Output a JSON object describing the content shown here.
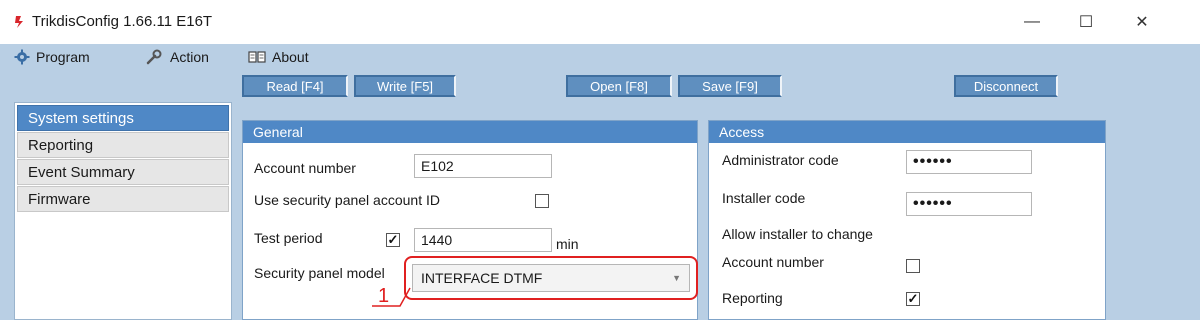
{
  "window": {
    "title": "TrikdisConfig 1.66.11   E16T",
    "minimize_glyph": "—",
    "maximize_glyph": "☐",
    "close_glyph": "✕"
  },
  "menu": {
    "program": "Program",
    "action": "Action",
    "about": "About"
  },
  "toolbar": {
    "read": "Read [F4]",
    "write": "Write [F5]",
    "open": "Open [F8]",
    "save": "Save [F9]",
    "disconnect": "Disconnect"
  },
  "sidebar": {
    "items": [
      {
        "label": "System settings",
        "active": true
      },
      {
        "label": "Reporting",
        "active": false
      },
      {
        "label": "Event Summary",
        "active": false
      },
      {
        "label": "Firmware",
        "active": false
      }
    ]
  },
  "general": {
    "title": "General",
    "account_number_label": "Account number",
    "account_number_value": "E102",
    "use_panel_id_label": "Use security panel account ID",
    "use_panel_id_checked": false,
    "test_period_label": "Test period",
    "test_period_checked": true,
    "test_period_value": "1440",
    "test_period_unit": "min",
    "panel_model_label": "Security panel model",
    "panel_model_value": "INTERFACE DTMF"
  },
  "access": {
    "title": "Access",
    "admin_code_label": "Administrator code",
    "admin_code_value": "••••••",
    "installer_code_label": "Installer code",
    "installer_code_value": "••••••",
    "allow_change_label": "Allow installer to change",
    "account_number_label": "Account number",
    "account_number_checked": false,
    "reporting_label": "Reporting",
    "reporting_checked": true
  },
  "callout": {
    "number": "1",
    "color": "#e02020"
  },
  "colors": {
    "accent": "#4f88c6",
    "chrome": "#b9cfe4",
    "toolbar_button": "#5f8fbf"
  }
}
